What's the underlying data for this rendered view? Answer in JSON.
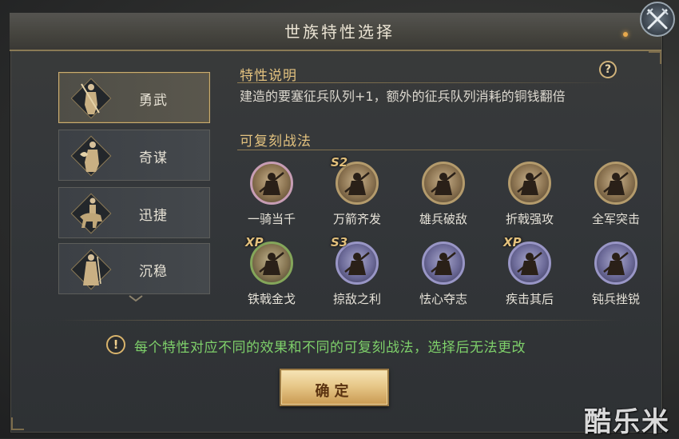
{
  "dialog": {
    "title": "世族特性选择",
    "close_icon": "crossed-swords-close-icon"
  },
  "traits": [
    {
      "label": "勇武",
      "icon": "warrior-icon",
      "selected": true
    },
    {
      "label": "奇谋",
      "icon": "strategist-icon",
      "selected": false
    },
    {
      "label": "迅捷",
      "icon": "cavalry-icon",
      "selected": false
    },
    {
      "label": "沉稳",
      "icon": "scholar-icon",
      "selected": false
    }
  ],
  "description": {
    "heading": "特性说明",
    "text": "建造的要塞征兵队列+1，额外的征兵队列消耗的铜钱翻倍",
    "help": "?"
  },
  "tactics": {
    "heading": "可复刻战法",
    "items": [
      {
        "name": "一骑当千",
        "badge": "",
        "ring": "pink"
      },
      {
        "name": "万箭齐发",
        "badge": "S2",
        "ring": "gold"
      },
      {
        "name": "雄兵破敌",
        "badge": "",
        "ring": "gold"
      },
      {
        "name": "折戟强攻",
        "badge": "",
        "ring": "gold"
      },
      {
        "name": "全军突击",
        "badge": "",
        "ring": "gold"
      },
      {
        "name": "铁戟金戈",
        "badge": "XP",
        "ring": "green"
      },
      {
        "name": "掠敌之利",
        "badge": "S3",
        "ring": "blue"
      },
      {
        "name": "怯心夺志",
        "badge": "",
        "ring": "blue"
      },
      {
        "name": "疾击其后",
        "badge": "XP",
        "ring": "blue"
      },
      {
        "name": "钝兵挫锐",
        "badge": "",
        "ring": "blue"
      }
    ]
  },
  "notice": {
    "icon": "!",
    "text": "每个特性对应不同的效果和不同的可复刻战法，选择后无法更改"
  },
  "confirm_label": "确定",
  "watermark": "酷乐米",
  "colors": {
    "accent_gold": "#e3c27f",
    "notice_green": "#7ed06a",
    "button_gold": "#e7c889"
  }
}
